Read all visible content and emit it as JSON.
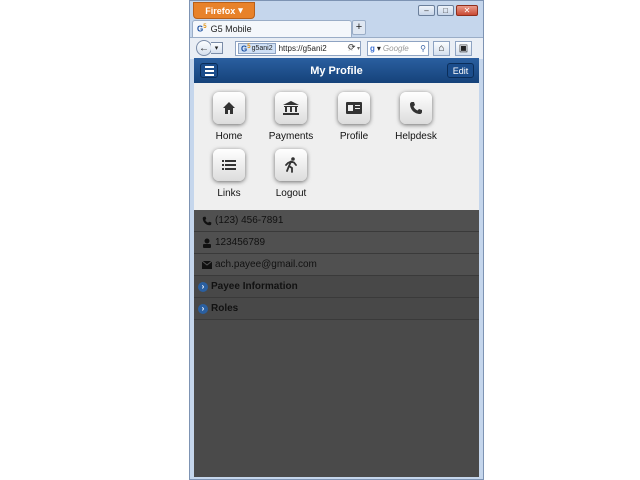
{
  "browser": {
    "app_button": "Firefox",
    "tab_title": "G5 Mobile",
    "url_identity": "g5ani2",
    "url_text": "https://g5ani2",
    "search_placeholder": "Google"
  },
  "header": {
    "title": "My Profile",
    "edit_label": "Edit"
  },
  "menu": {
    "items": [
      {
        "label": "Home",
        "icon": "home-icon"
      },
      {
        "label": "Payments",
        "icon": "bank-icon"
      },
      {
        "label": "Profile",
        "icon": "id-card-icon"
      },
      {
        "label": "Helpdesk",
        "icon": "phone-icon"
      },
      {
        "label": "Links",
        "icon": "list-icon"
      },
      {
        "label": "Logout",
        "icon": "running-man-icon"
      }
    ]
  },
  "profile": {
    "phone": "(123) 456-7891",
    "account": "123456789",
    "email": "ach.payee@gmail.com",
    "sections": [
      "Payee Information",
      "Roles"
    ]
  },
  "colors": {
    "header": "#1d4f8c",
    "overlay": "#4a4a4a",
    "menu": "#efefef"
  }
}
